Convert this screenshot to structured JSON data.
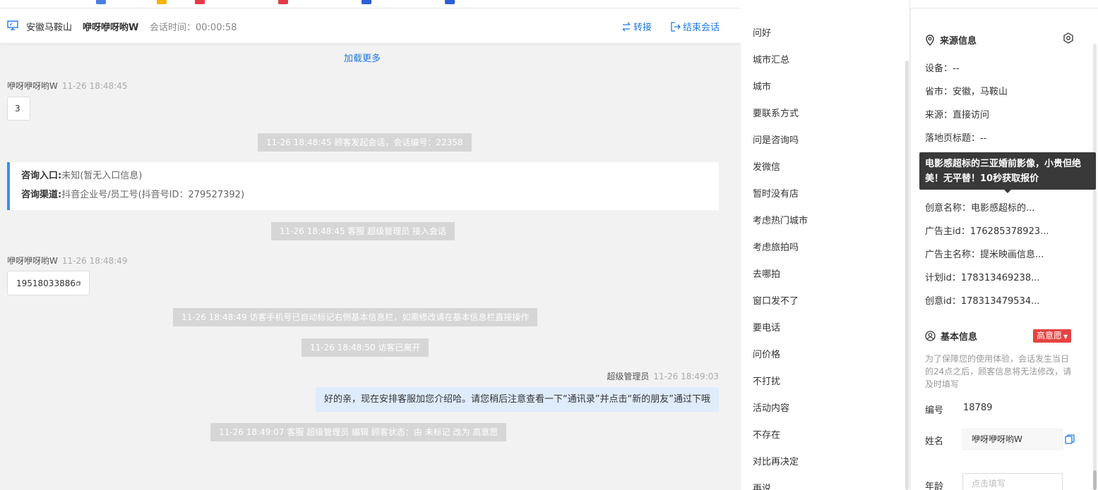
{
  "header": {
    "location": "安徽马鞍山",
    "visitor_name": "咿呀咿呀哟W",
    "session_time": "会话时间：00:00:58",
    "transfer_label": "转接",
    "end_label": "结束会话"
  },
  "chat": {
    "load_more": "加载更多",
    "msg1": {
      "sender": "咿呀咿呀哟W",
      "time": "11-26 18:48:45",
      "text": "3"
    },
    "sys1": "11-26 18:48:45 顾客发起会话，会话编号：22358",
    "entry": {
      "entry_key": "咨询入口:",
      "entry_val": "未知(暂无入口信息)",
      "channel_key": "咨询渠道:",
      "channel_val": "抖音企业号/员工号(抖音号ID：279527392)"
    },
    "sys2": "11-26 18:48:45 客服 超级管理员 接入会话",
    "msg2": {
      "sender": "咿呀咿呀哟W",
      "time": "11-26 18:48:49",
      "text": "19518033886"
    },
    "sys3": "11-26 18:48:49 访客手机号已自动标记右侧基本信息栏，如需修改请在基本信息栏直接操作",
    "sys4": "11-26 18:48:50 访客已离开",
    "agent": {
      "sender": "超级管理员",
      "time": "11-26 18:49:03",
      "text": "好的亲，现在安排客服加您介绍哈。请您稍后注意查看一下“通讯录”并点击“新的朋友”通过下哦"
    },
    "sys5": "11-26 18:49:07 客服 超级管理员 编辑 顾客状态：由 未标记 改为 高意愿"
  },
  "quick_replies": [
    "问好",
    "城市汇总",
    "城市",
    "要联系方式",
    "问是咨询吗",
    "发微信",
    "暂时没有店",
    "考虑热门城市",
    "考虑旅拍吗",
    "去哪拍",
    "窗口发不了",
    "要电话",
    "问价格",
    "不打扰",
    "活动内容",
    "不存在",
    "对比再决定",
    "再说"
  ],
  "source_info": {
    "title": "来源信息",
    "device": "设备：--",
    "province": "省市：安徽，马鞍山",
    "source": "来源：直接访问",
    "landing_title": "落地页标题：--",
    "creative_name": "创意名称：电影感超标的...",
    "advertiser_id": "广告主id：176285378923...",
    "advertiser_name": "广告主名称：提米映画信息...",
    "plan_id": "计划id：178313469238...",
    "creative_id": "创意id：178313479534..."
  },
  "tooltip_text": "电影感超标的三亚婚前影像，小贵但绝美！无平替！10秒获取报价",
  "basic_info": {
    "title": "基本信息",
    "tag": "高意愿",
    "hint": "为了保障您的使用体验，会话发生当日的24点之后，顾客信息将无法修改，请及时填写",
    "number_label": "编号",
    "number_value": "18789",
    "name_label": "姓名",
    "name_value": "咿呀咿呀哟W",
    "age_label": "年龄",
    "age_placeholder": "点击填写"
  },
  "colors": {
    "accent": "#1e78e8",
    "intent_tag": "#e64340",
    "agent_bubble": "#deecfc"
  }
}
